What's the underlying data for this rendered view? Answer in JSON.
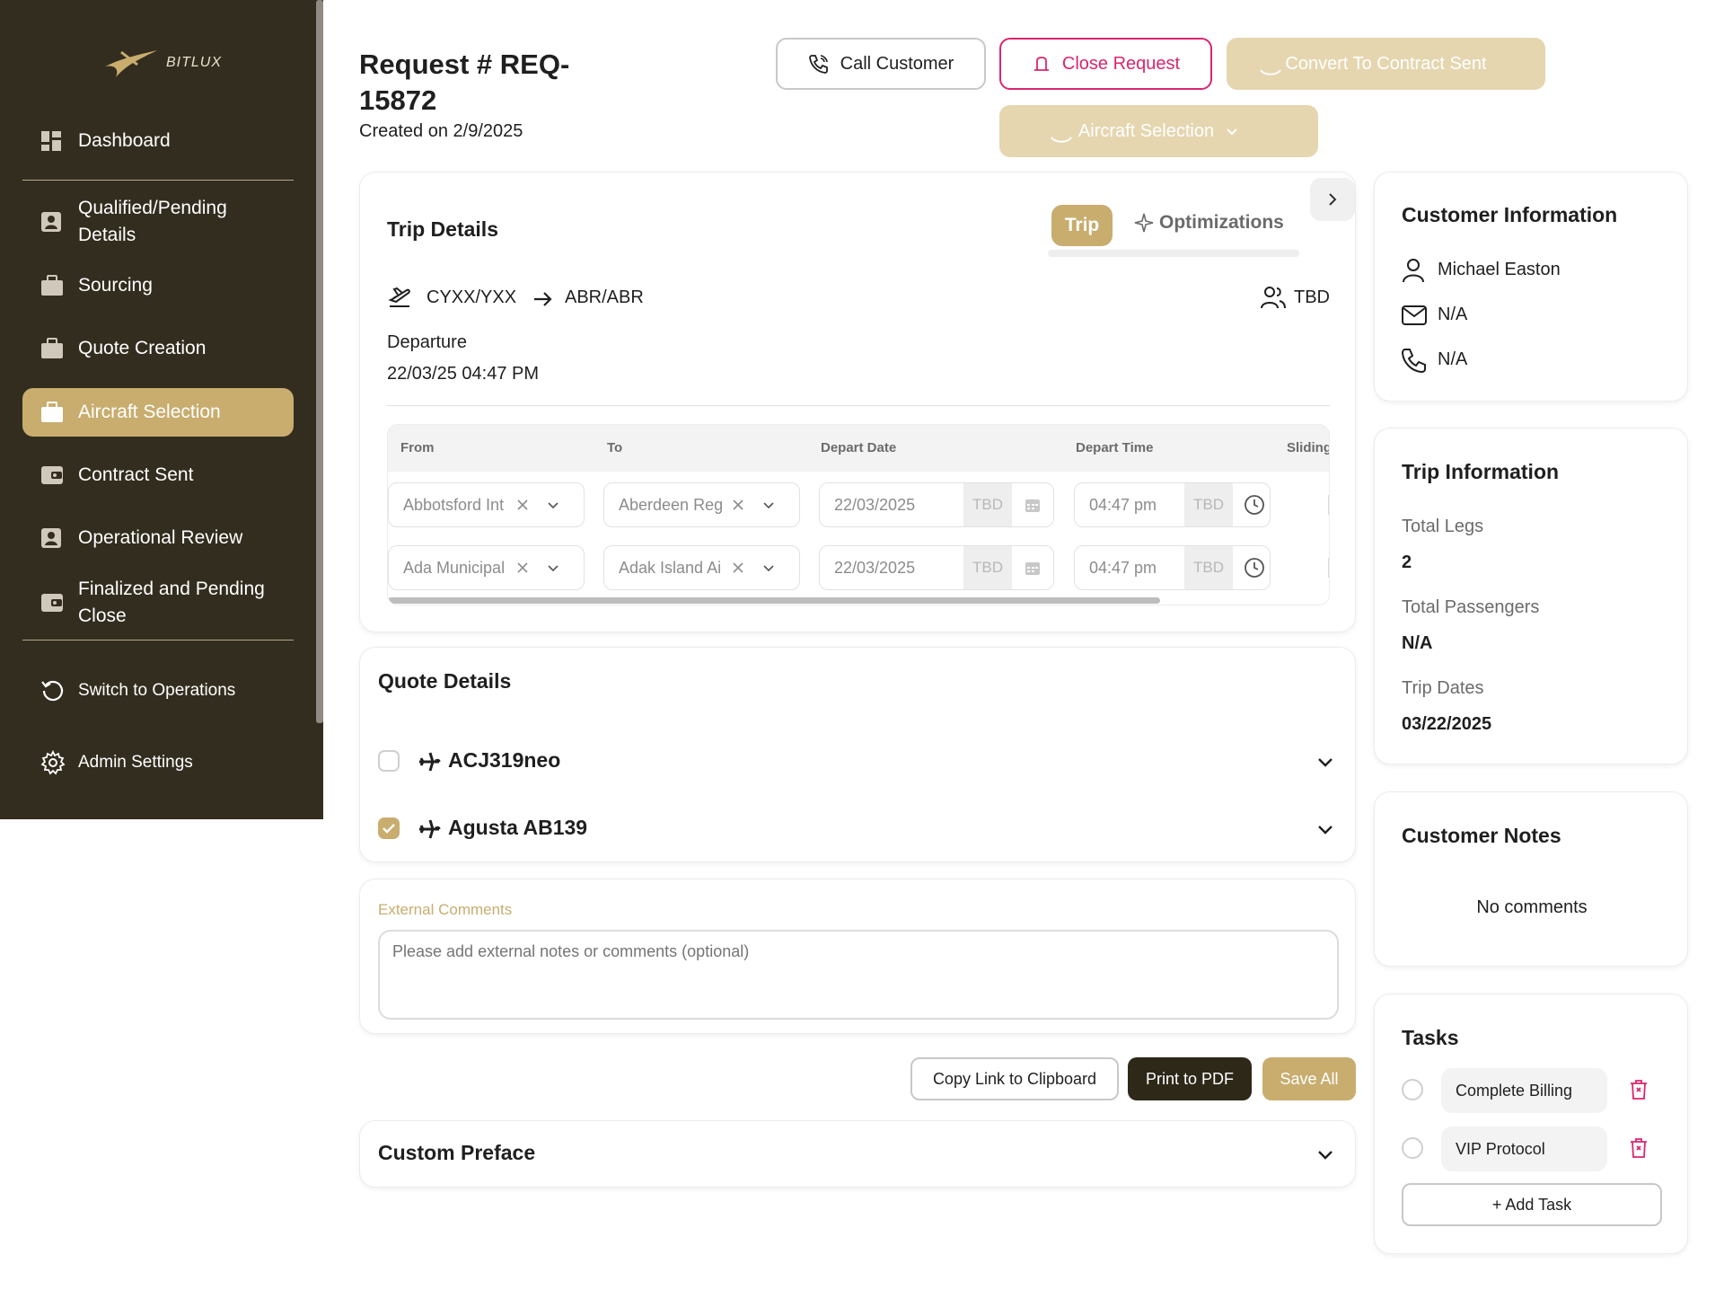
{
  "brand": {
    "name": "BITLUX"
  },
  "sidebar": {
    "items": [
      {
        "label": "Dashboard",
        "icon": "dashboard-icon"
      },
      {
        "label": "Qualified/Pending Details",
        "icon": "user-card-icon"
      },
      {
        "label": "Sourcing",
        "icon": "briefcase-icon"
      },
      {
        "label": "Quote Creation",
        "icon": "briefcase-icon"
      },
      {
        "label": "Aircraft Selection",
        "icon": "briefcase-icon",
        "active": true
      },
      {
        "label": "Contract Sent",
        "icon": "wallet-icon"
      },
      {
        "label": "Operational Review",
        "icon": "user-card-icon"
      },
      {
        "label": "Finalized and Pending Close",
        "icon": "wallet-icon"
      }
    ],
    "footer": [
      {
        "label": "Switch to Operations",
        "icon": "refresh-icon"
      },
      {
        "label": "Admin Settings",
        "icon": "gear-icon"
      }
    ]
  },
  "header": {
    "title": "Request # REQ-15872",
    "created": "Created on 2/9/2025",
    "call_customer": "Call Customer",
    "close_request": "Close Request",
    "convert_contract": "Convert To Contract Sent",
    "aircraft_selection": "Aircraft Selection"
  },
  "trip": {
    "title": "Trip Details",
    "tab_trip": "Trip",
    "tab_optimizations": "Optimizations",
    "from_code": "CYXX/YXX",
    "to_code": "ABR/ABR",
    "passengers": "TBD",
    "departure_label": "Departure",
    "departure_value": "22/03/25 04:47 PM",
    "columns": [
      "From",
      "To",
      "Depart Date",
      "Depart Time",
      "Sliding"
    ],
    "rows": [
      {
        "from": "Abbotsford Int",
        "to": "Aberdeen Reg",
        "date": "22/03/2025",
        "date_tbd": "TBD",
        "time": "04:47 pm",
        "time_tbd": "TBD"
      },
      {
        "from": "Ada Municipal",
        "to": "Adak Island Ai",
        "date": "22/03/2025",
        "date_tbd": "TBD",
        "time": "04:47 pm",
        "time_tbd": "TBD"
      }
    ]
  },
  "quote": {
    "title": "Quote Details",
    "items": [
      {
        "name": "ACJ319neo",
        "checked": false
      },
      {
        "name": "Agusta AB139",
        "checked": true
      }
    ]
  },
  "comments": {
    "label": "External Comments",
    "placeholder": "Please add external notes or comments (optional)"
  },
  "actions": {
    "copy_link": "Copy Link to Clipboard",
    "print_pdf": "Print to PDF",
    "save_all": "Save All"
  },
  "preface": {
    "title": "Custom Preface"
  },
  "customer": {
    "title": "Customer Information",
    "name": "Michael Easton",
    "email": "N/A",
    "phone": "N/A"
  },
  "trip_info": {
    "title": "Trip Information",
    "legs_label": "Total Legs",
    "legs_value": "2",
    "passengers_label": "Total Passengers",
    "passengers_value": "N/A",
    "dates_label": "Trip Dates",
    "dates_value": "03/22/2025"
  },
  "notes": {
    "title": "Customer Notes",
    "empty": "No comments"
  },
  "tasks": {
    "title": "Tasks",
    "items": [
      {
        "label": "Complete Billing"
      },
      {
        "label": "VIP Protocol"
      }
    ],
    "add_label": "+ Add Task"
  },
  "colors": {
    "sidebar_bg": "#332d1f",
    "accent_gold": "#c8ad6f",
    "accent_gold_light": "#e5d6b0",
    "danger_pink": "#d9266f",
    "dark_button": "#2e2819"
  }
}
